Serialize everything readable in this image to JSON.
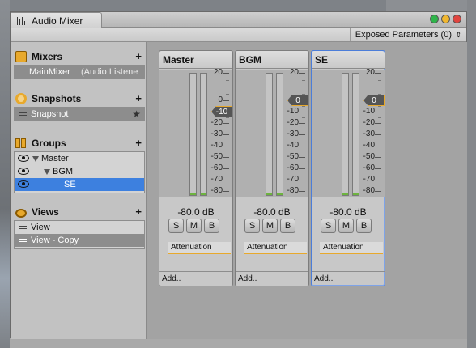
{
  "window": {
    "tab_title": "Audio Mixer",
    "traffic_lights": [
      "#2fb44a",
      "#f1b730",
      "#e0443e"
    ]
  },
  "toolbar": {
    "exposed_parameters": "Exposed Parameters (0)",
    "exposed_chevron": "⇕"
  },
  "sidebar": {
    "mixers": {
      "title": "Mixers",
      "add": "+",
      "items": [
        {
          "name": "MainMixer",
          "output": "(Audio Listene"
        }
      ]
    },
    "snapshots": {
      "title": "Snapshots",
      "add": "+",
      "items": [
        {
          "label": "Snapshot",
          "star": "★"
        }
      ]
    },
    "groups": {
      "title": "Groups",
      "add": "+",
      "items": [
        "Master",
        "BGM",
        "SE"
      ]
    },
    "views": {
      "title": "Views",
      "add": "+",
      "items": [
        "View",
        "View - Copy"
      ]
    }
  },
  "strips": [
    {
      "name": "Master",
      "level": "-80.0 dB",
      "volume": "-10",
      "volume_db": -10,
      "solo": "S",
      "mute": "M",
      "bypass": "B",
      "effect": "Attenuation",
      "add": "Add.."
    },
    {
      "name": "BGM",
      "level": "-80.0 dB",
      "volume": "0",
      "volume_db": 0,
      "solo": "S",
      "mute": "M",
      "bypass": "B",
      "effect": "Attenuation",
      "add": "Add.."
    },
    {
      "name": "SE",
      "level": "-80.0 dB",
      "volume": "0",
      "volume_db": 0,
      "solo": "S",
      "mute": "M",
      "bypass": "B",
      "effect": "Attenuation",
      "add": "Add.."
    }
  ],
  "meter_scale": [
    "20",
    "0",
    "-10",
    "-20",
    "-30",
    "-40",
    "-50",
    "-60",
    "-70",
    "-80"
  ],
  "accent_colors": {
    "effect_bar": "#e8a92c",
    "selection_blue": "#3d80df",
    "meter_floor": "#6db33f"
  }
}
